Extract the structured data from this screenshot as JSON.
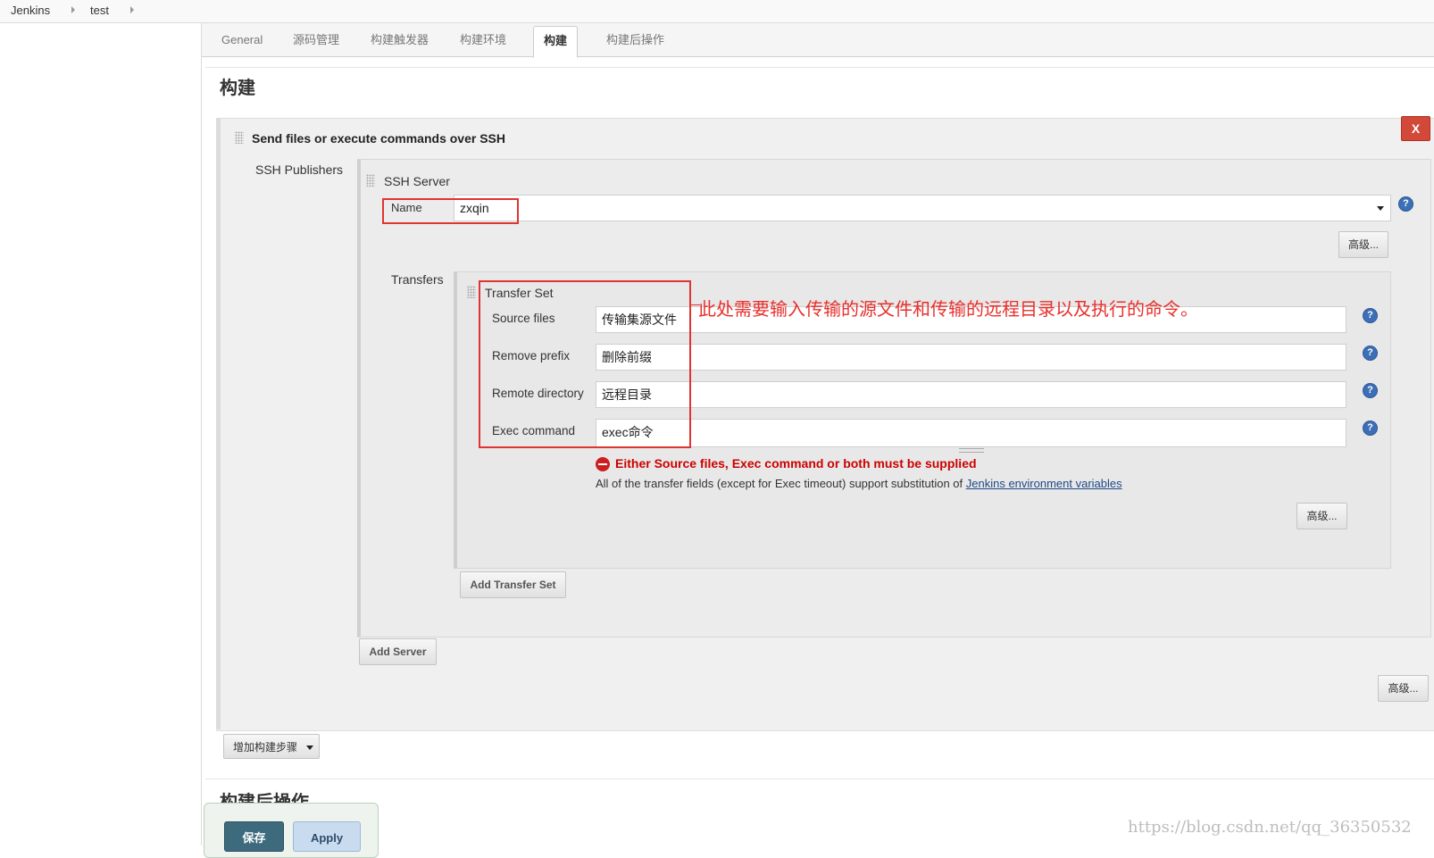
{
  "breadcrumb": {
    "items": [
      "Jenkins",
      "test"
    ]
  },
  "tabs": [
    {
      "label": "General"
    },
    {
      "label": "源码管理"
    },
    {
      "label": "构建触发器"
    },
    {
      "label": "构建环境"
    },
    {
      "label": "构建"
    },
    {
      "label": "构建后操作"
    }
  ],
  "active_tab": "构建",
  "section": {
    "title": "构建"
  },
  "build_step": {
    "title": "Send files or execute commands over SSH",
    "delete_label": "X",
    "publishers_label": "SSH Publishers",
    "server_header": "SSH Server",
    "name_label": "Name",
    "name_value": "zxqin",
    "server_advanced_label": "高级...",
    "transfers_label": "Transfers",
    "transfer_set": {
      "header": "Transfer Set",
      "source_files_label": "Source files",
      "source_files_value": "传输集源文件",
      "remove_prefix_label": "Remove prefix",
      "remove_prefix_value": "删除前缀",
      "remote_directory_label": "Remote directory",
      "remote_directory_value": "远程目录",
      "exec_command_label": "Exec command",
      "exec_command_value": "exec命令",
      "error_text": "Either Source files, Exec command or both must be supplied",
      "hint_prefix": "All of the transfer fields (except for Exec timeout) support substitution of ",
      "hint_link": "Jenkins environment variables",
      "advanced_label": "高级..."
    },
    "add_transfer_set_label": "Add Transfer Set",
    "add_server_label": "Add Server",
    "step_advanced_label": "高级..."
  },
  "add_build_step_label": "增加构建步骤",
  "post_build": {
    "title": "构建后操作"
  },
  "annotation": "此处需要输入传输的源文件和传输的远程目录以及执行的命令。",
  "footer": {
    "save_label": "保存",
    "apply_label": "Apply"
  },
  "watermark": "https://blog.csdn.net/qq_36350532",
  "colors": {
    "annotation": "#e8302c",
    "error": "#cc0000",
    "delete": "#d24939",
    "save": "#3d6b7d",
    "apply": "#c9dcef"
  }
}
